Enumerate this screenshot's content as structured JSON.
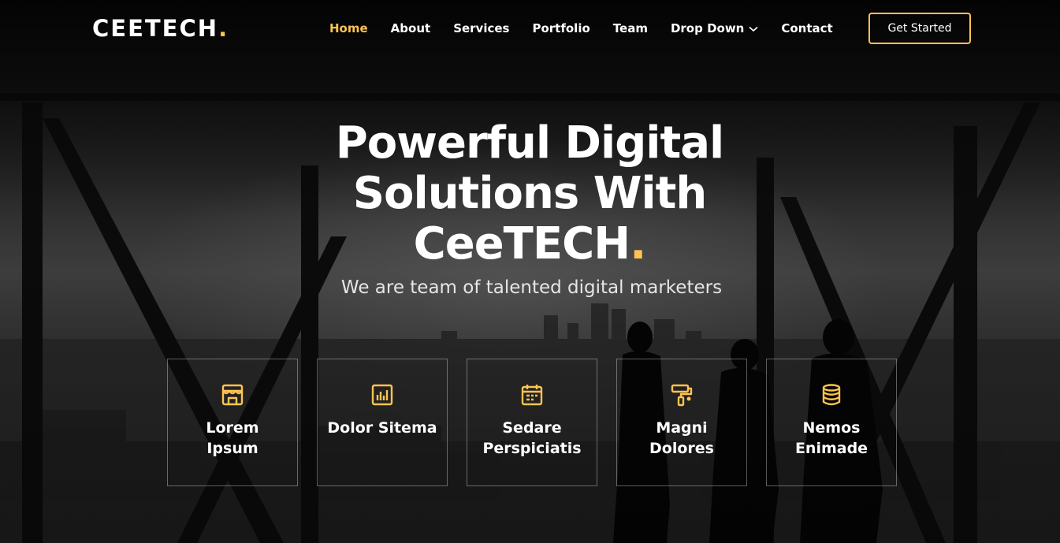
{
  "brand": {
    "name": "CEETECH",
    "dot": "."
  },
  "nav": {
    "items": [
      {
        "label": "Home",
        "active": true
      },
      {
        "label": "About"
      },
      {
        "label": "Services"
      },
      {
        "label": "Portfolio"
      },
      {
        "label": "Team"
      },
      {
        "label": "Drop Down",
        "has_dropdown": true
      },
      {
        "label": "Contact"
      }
    ],
    "cta_label": "Get Started"
  },
  "hero": {
    "title_line1": "Powerful Digital",
    "title_line2": "Solutions With",
    "title_line3": "CeeTECH",
    "title_dot": ".",
    "subtitle": "We are team of talented digital marketers"
  },
  "features": [
    {
      "icon": "store-icon",
      "title_line1": "Lorem",
      "title_line2": "Ipsum"
    },
    {
      "icon": "bar-chart-icon",
      "title_line1": "Dolor Sitema",
      "title_line2": ""
    },
    {
      "icon": "calendar-icon",
      "title_line1": "Sedare",
      "title_line2": "Perspiciatis"
    },
    {
      "icon": "paint-roller-icon",
      "title_line1": "Magni",
      "title_line2": "Dolores"
    },
    {
      "icon": "database-icon",
      "title_line1": "Nemos",
      "title_line2": "Enimade"
    }
  ],
  "colors": {
    "accent": "#ffc451",
    "text": "#ffffff"
  }
}
